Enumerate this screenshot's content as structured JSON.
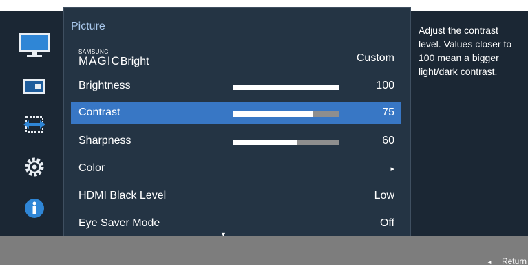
{
  "menu": {
    "title": "Picture",
    "items": [
      {
        "brand": "SAMSUNG",
        "label_main": "MAGIC",
        "label_suffix": "Bright",
        "value": "Custom"
      },
      {
        "label": "Brightness",
        "value": "100",
        "level": 100
      },
      {
        "label": "Contrast",
        "value": "75",
        "level": 75
      },
      {
        "label": "Sharpness",
        "value": "60",
        "level": 60
      },
      {
        "label": "Color",
        "value": "▸"
      },
      {
        "label": "HDMI Black Level",
        "value": "Low"
      },
      {
        "label": "Eye Saver Mode",
        "value": "Off"
      }
    ],
    "scroll_indicator": "▼"
  },
  "help": {
    "text": "Adjust the contrast level. Values closer to 100 mean a bigger light/dark contrast."
  },
  "footer": {
    "return_arrow": "◄",
    "return_label": "Return"
  },
  "sidebar": {
    "icons": [
      "picture-monitor-icon",
      "onscreen-display-icon",
      "position-arrows-icon",
      "settings-gear-icon",
      "information-icon"
    ]
  },
  "colors": {
    "selected_row": "#3877c5",
    "title": "#a9c8ec",
    "panel": "#243444",
    "background": "#1b2734"
  }
}
